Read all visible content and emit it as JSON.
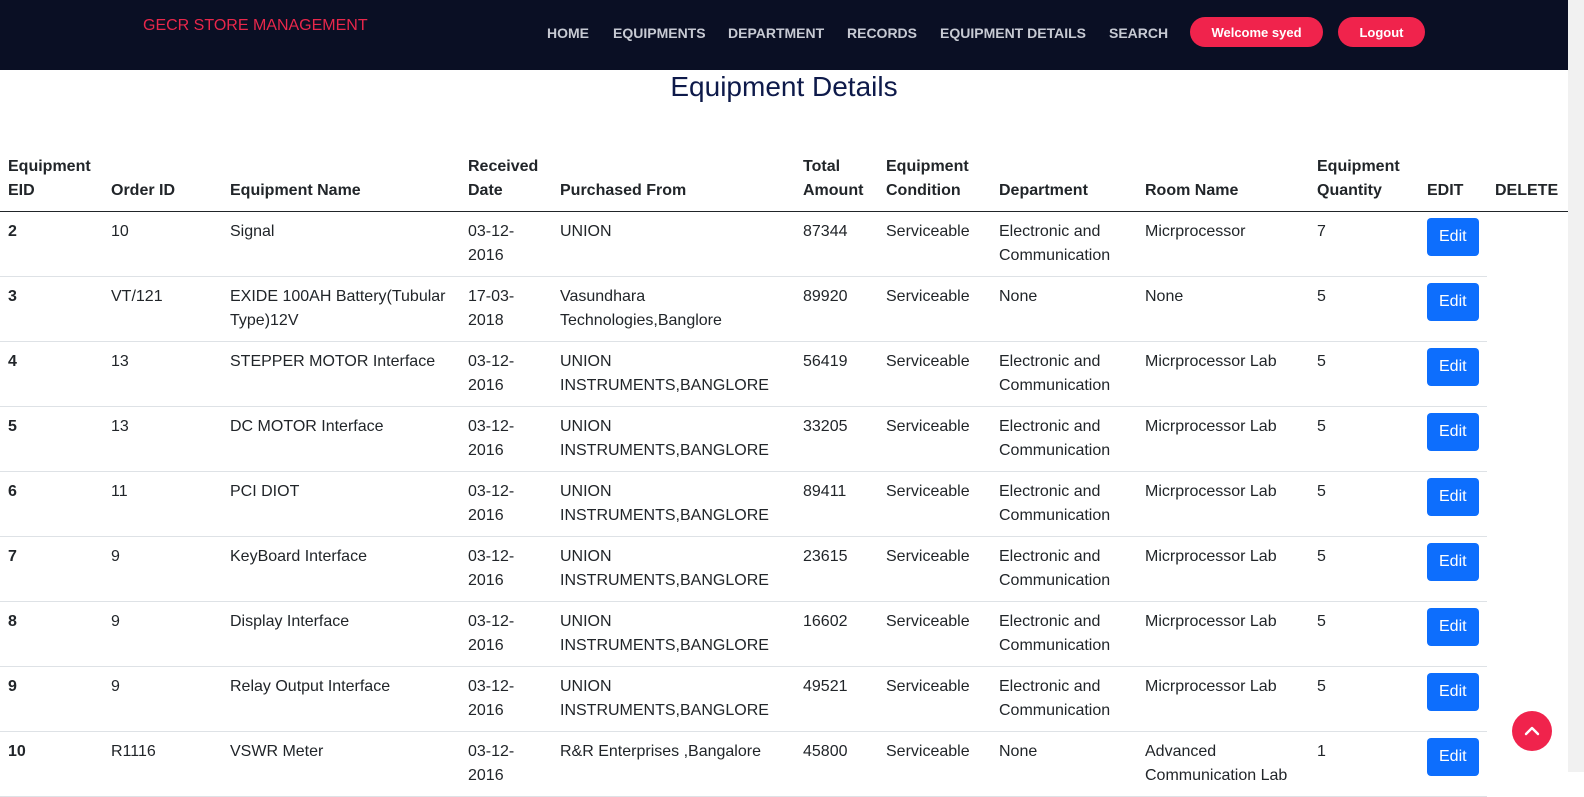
{
  "brand": "GECR STORE MANAGEMENT",
  "nav": [
    {
      "label": "HOME"
    },
    {
      "label": "EQUIPMENTS"
    },
    {
      "label": "DEPARTMENT"
    },
    {
      "label": "RECORDS"
    },
    {
      "label": "EQUIPMENT DETAILS"
    },
    {
      "label": "SEARCH"
    }
  ],
  "welcome_label": "Welcome syed",
  "logout_label": "Logout",
  "page_title": "Equipment Details",
  "headers": {
    "eid": "Equipment EID",
    "order_id": "Order ID",
    "name": "Equipment Name",
    "received": "Received Date",
    "purchased": "Purchased From",
    "amount": "Total Amount",
    "condition": "Equipment Condition",
    "department": "Department",
    "room": "Room Name",
    "quantity": "Equipment Quantity",
    "edit": "EDIT",
    "delete": "DELETE"
  },
  "edit_label": "Edit",
  "rows": [
    {
      "eid": "2",
      "order_id": "10",
      "name": "Signal",
      "received": "03-12-2016",
      "purchased": "UNION",
      "amount": "87344",
      "condition": "Serviceable",
      "department": "Electronic and Communication",
      "room": "Micrprocessor",
      "quantity": "7"
    },
    {
      "eid": "3",
      "order_id": "VT/121",
      "name": "EXIDE 100AH Battery(Tubular Type)12V",
      "received": "17-03-2018",
      "purchased": "Vasundhara Technologies,Banglore",
      "amount": "89920",
      "condition": "Serviceable",
      "department": "None",
      "room": "None",
      "quantity": "5"
    },
    {
      "eid": "4",
      "order_id": "13",
      "name": "STEPPER MOTOR Interface",
      "received": "03-12-2016",
      "purchased": "UNION INSTRUMENTS,BANGLORE",
      "amount": "56419",
      "condition": "Serviceable",
      "department": "Electronic and Communication",
      "room": "Micrprocessor Lab",
      "quantity": "5"
    },
    {
      "eid": "5",
      "order_id": "13",
      "name": "DC MOTOR Interface",
      "received": "03-12-2016",
      "purchased": "UNION INSTRUMENTS,BANGLORE",
      "amount": "33205",
      "condition": "Serviceable",
      "department": "Electronic and Communication",
      "room": "Micrprocessor Lab",
      "quantity": "5"
    },
    {
      "eid": "6",
      "order_id": "11",
      "name": "PCI DIOT",
      "received": "03-12-2016",
      "purchased": "UNION INSTRUMENTS,BANGLORE",
      "amount": "89411",
      "condition": "Serviceable",
      "department": "Electronic and Communication",
      "room": "Micrprocessor Lab",
      "quantity": "5"
    },
    {
      "eid": "7",
      "order_id": "9",
      "name": "KeyBoard Interface",
      "received": "03-12-2016",
      "purchased": "UNION INSTRUMENTS,BANGLORE",
      "amount": "23615",
      "condition": "Serviceable",
      "department": "Electronic and Communication",
      "room": "Micrprocessor Lab",
      "quantity": "5"
    },
    {
      "eid": "8",
      "order_id": "9",
      "name": "Display Interface",
      "received": "03-12-2016",
      "purchased": "UNION INSTRUMENTS,BANGLORE",
      "amount": "16602",
      "condition": "Serviceable",
      "department": "Electronic and Communication",
      "room": "Micrprocessor Lab",
      "quantity": "5"
    },
    {
      "eid": "9",
      "order_id": "9",
      "name": "Relay Output Interface",
      "received": "03-12-2016",
      "purchased": "UNION INSTRUMENTS,BANGLORE",
      "amount": "49521",
      "condition": "Serviceable",
      "department": "Electronic and Communication",
      "room": "Micrprocessor Lab",
      "quantity": "5"
    },
    {
      "eid": "10",
      "order_id": "R1116",
      "name": "VSWR Meter",
      "received": "03-12-2016",
      "purchased": "R&R Enterprises ,Bangalore",
      "amount": "45800",
      "condition": "Serviceable",
      "department": "None",
      "room": "Advanced Communication Lab",
      "quantity": "1"
    }
  ],
  "icons": {
    "scroll_top": "chevron-up-icon"
  },
  "colors": {
    "navbar_bg": "#0a0f24",
    "brand": "#e8274b",
    "pill": "#f0234c",
    "edit_button": "#0d6efd",
    "title": "#0e1a4a"
  }
}
